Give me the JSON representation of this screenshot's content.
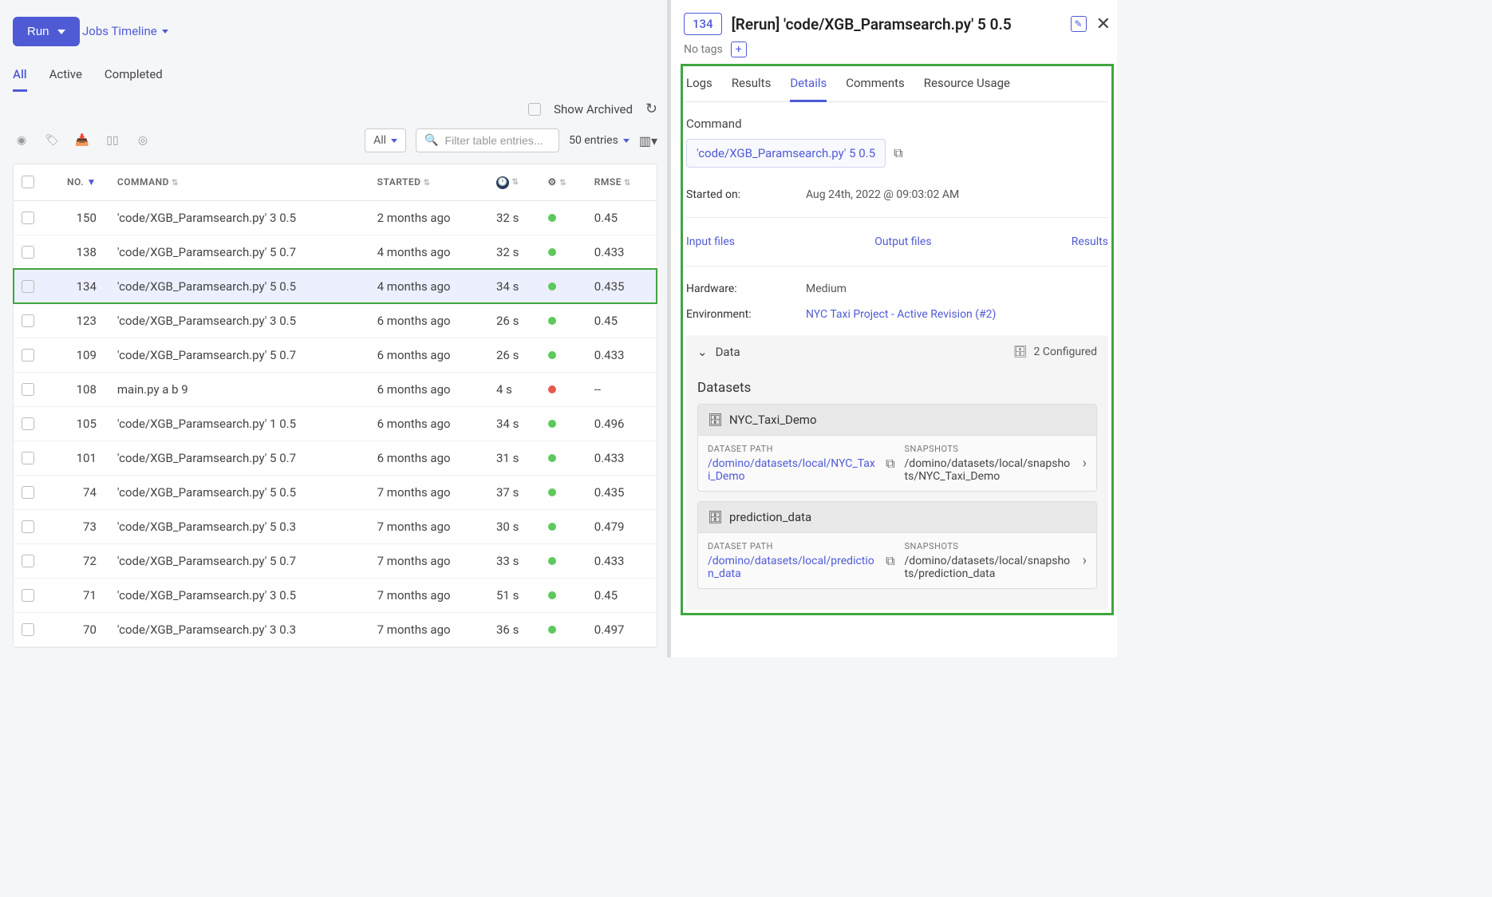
{
  "header": {
    "run_button": "Run",
    "jobs_timeline": "Jobs Timeline"
  },
  "tabs": {
    "all": "All",
    "active": "Active",
    "completed": "Completed"
  },
  "toolbar": {
    "show_archived": "Show Archived",
    "all_filter": "All",
    "search_placeholder": "Filter table entries...",
    "entries": "50 entries"
  },
  "columns": {
    "no": "NO.",
    "command": "COMMAND",
    "started": "STARTED",
    "rmse": "RMSE"
  },
  "rows": [
    {
      "no": "150",
      "command": "'code/XGB_Paramsearch.py' 3 0.5",
      "started": "2 months ago",
      "dur": "32 s",
      "status": "green",
      "rmse": "0.45"
    },
    {
      "no": "138",
      "command": "'code/XGB_Paramsearch.py' 5 0.7",
      "started": "4 months ago",
      "dur": "32 s",
      "status": "green",
      "rmse": "0.433"
    },
    {
      "no": "134",
      "command": "'code/XGB_Paramsearch.py' 5 0.5",
      "started": "4 months ago",
      "dur": "34 s",
      "status": "green",
      "rmse": "0.435",
      "selected": true
    },
    {
      "no": "123",
      "command": "'code/XGB_Paramsearch.py' 3 0.5",
      "started": "6 months ago",
      "dur": "26 s",
      "status": "green",
      "rmse": "0.45"
    },
    {
      "no": "109",
      "command": "'code/XGB_Paramsearch.py' 5 0.7",
      "started": "6 months ago",
      "dur": "26 s",
      "status": "green",
      "rmse": "0.433"
    },
    {
      "no": "108",
      "command": "main.py a b 9",
      "started": "6 months ago",
      "dur": "4 s",
      "status": "red",
      "rmse": "--"
    },
    {
      "no": "105",
      "command": "'code/XGB_Paramsearch.py' 1 0.5",
      "started": "6 months ago",
      "dur": "34 s",
      "status": "green",
      "rmse": "0.496"
    },
    {
      "no": "101",
      "command": "'code/XGB_Paramsearch.py' 5 0.7",
      "started": "6 months ago",
      "dur": "31 s",
      "status": "green",
      "rmse": "0.433"
    },
    {
      "no": "74",
      "command": "'code/XGB_Paramsearch.py' 5 0.5",
      "started": "7 months ago",
      "dur": "37 s",
      "status": "green",
      "rmse": "0.435"
    },
    {
      "no": "73",
      "command": "'code/XGB_Paramsearch.py' 5 0.3",
      "started": "7 months ago",
      "dur": "30 s",
      "status": "green",
      "rmse": "0.479"
    },
    {
      "no": "72",
      "command": "'code/XGB_Paramsearch.py' 5 0.7",
      "started": "7 months ago",
      "dur": "33 s",
      "status": "green",
      "rmse": "0.433"
    },
    {
      "no": "71",
      "command": "'code/XGB_Paramsearch.py' 3 0.5",
      "started": "7 months ago",
      "dur": "51 s",
      "status": "green",
      "rmse": "0.45"
    },
    {
      "no": "70",
      "command": "'code/XGB_Paramsearch.py' 3 0.3",
      "started": "7 months ago",
      "dur": "36 s",
      "status": "green",
      "rmse": "0.497"
    }
  ],
  "detail": {
    "run_id": "134",
    "title": "[Rerun] 'code/XGB_Paramsearch.py' 5 0.5",
    "no_tags": "No tags",
    "tabs": {
      "logs": "Logs",
      "results": "Results",
      "details": "Details",
      "comments": "Comments",
      "resource": "Resource Usage"
    },
    "command_label": "Command",
    "command_value": "'code/XGB_Paramsearch.py' 5 0.5",
    "started_label": "Started on:",
    "started_value": "Aug 24th, 2022 @ 09:03:02 AM",
    "input_files": "Input files",
    "output_files": "Output files",
    "results_link": "Results",
    "hardware_label": "Hardware:",
    "hardware_value": "Medium",
    "env_label": "Environment:",
    "env_value": "NYC Taxi Project - Active Revision (#2)",
    "data_label": "Data",
    "configured": "2 Configured",
    "datasets_label": "Datasets",
    "ds_path_label": "DATASET PATH",
    "snapshots_label": "SNAPSHOTS",
    "datasets": [
      {
        "name": "NYC_Taxi_Demo",
        "path": "/domino/datasets/local/NYC_Taxi_Demo",
        "snap": "/domino/datasets/local/snapshots/NYC_Taxi_Demo"
      },
      {
        "name": "prediction_data",
        "path": "/domino/datasets/local/prediction_data",
        "snap": "/domino/datasets/local/snapshots/prediction_data"
      }
    ]
  }
}
